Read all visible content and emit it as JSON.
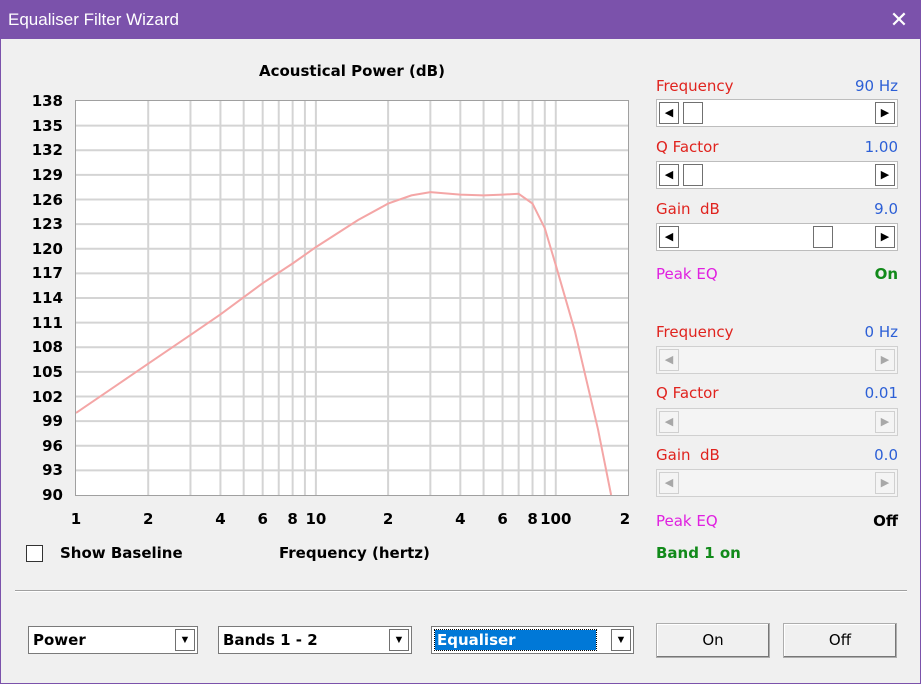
{
  "window": {
    "title": "Equaliser Filter Wizard",
    "close_glyph": "✕"
  },
  "chart": {
    "title": "Acoustical Power (dB)",
    "xlabel": "Frequency (hertz)",
    "yticks": [
      "138",
      "135",
      "132",
      "129",
      "126",
      "123",
      "120",
      "117",
      "114",
      "111",
      "108",
      "105",
      "102",
      "99",
      "96",
      "93",
      "90"
    ],
    "xticks": [
      "1",
      "2",
      "4",
      "6",
      "8",
      "10",
      "2",
      "4",
      "6",
      "8",
      "100",
      "2"
    ]
  },
  "chart_data": {
    "type": "line",
    "title": "Acoustical Power (dB)",
    "xlabel": "Frequency (hertz)",
    "ylabel": "",
    "x_scale": "log",
    "xlim": [
      1,
      200
    ],
    "ylim": [
      90,
      138
    ],
    "grid": true,
    "series": [
      {
        "color": "#f4a6a6",
        "x": [
          1,
          1.5,
          2,
          3,
          4,
          6,
          8,
          10,
          15,
          20,
          25,
          30,
          40,
          50,
          60,
          70,
          80,
          90,
          100,
          120,
          150,
          170
        ],
        "y": [
          100,
          103.5,
          106,
          109.5,
          112,
          115.8,
          118.2,
          120.2,
          123.5,
          125.5,
          126.5,
          126.9,
          126.6,
          126.5,
          126.6,
          126.7,
          125.5,
          122.5,
          118,
          110,
          98,
          90
        ]
      }
    ]
  },
  "baseline": {
    "label": "Show Baseline",
    "checked": false
  },
  "band1": {
    "frequency": {
      "label": "Frequency",
      "value": "90 Hz",
      "position": 0.1
    },
    "q_factor": {
      "label": "Q Factor",
      "value": "1.00",
      "position": 0.1
    },
    "gain": {
      "label": "Gain  dB",
      "value": "9.0",
      "position": 0.7
    },
    "mode": {
      "label": "Peak EQ",
      "state": "On"
    }
  },
  "band2": {
    "frequency": {
      "label": "Frequency",
      "value": "0 Hz"
    },
    "q_factor": {
      "label": "Q Factor",
      "value": "0.01"
    },
    "gain": {
      "label": "Gain  dB",
      "value": "0.0"
    },
    "mode": {
      "label": "Peak EQ",
      "state": "Off"
    }
  },
  "status": {
    "band_status": "Band 1 on"
  },
  "controls": {
    "combo_view": "Power",
    "combo_bands": "Bands 1 - 2",
    "combo_type": "Equaliser",
    "on_button": "On",
    "off_button": "Off"
  },
  "colors": {
    "title_bar": "#7b52ab",
    "curve": "#f4a6a6",
    "label_red": "#e0231e",
    "value_blue": "#2c5fd6",
    "mode_magenta": "#e020e0",
    "status_green": "#118a1a"
  }
}
